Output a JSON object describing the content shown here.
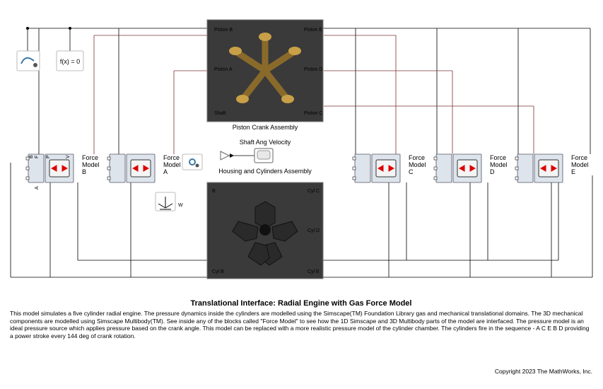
{
  "title": "Translational Interface: Radial Engine with Gas Force Model",
  "description": "This model simulates a five cylinder radial engine. The pressure dynamics inside the cylinders are modelled using the Simscape(TM) Foundation Library gas and mechanical translational domains. The 3D mechanical components are modelled using Simscape Multibody(TM). See inside any of the blocks called \"Force Model\" to see how the 1D Simscape and 3D Multibody parts of the model are interfaced. The pressure model is an ideal pressure source which applies pressure based on the crank angle. This model can be replaced with a more realistic pressure model of the cylinder chamber. The cylinders fire in the sequence - A C E B D providing a power stroke every 144 deg of crank rotation.",
  "copyright": "Copyright 2023 The MathWorks, Inc.",
  "solver": {
    "fx": "f(x) = 0"
  },
  "piston_block": {
    "caption": "Piston   Crank Assembly",
    "ports": {
      "pa": "Piston A",
      "pb": "Piston B",
      "pc": "Piston C",
      "pd": "Piston D",
      "pe": "Piston E",
      "shaft": "Shaft"
    }
  },
  "housing_block": {
    "caption": "Housing and Cylinders Assembly",
    "top_label": "Shaft Ang Velocity",
    "ports": {
      "cb": "Cyl B",
      "cc": "Cyl C",
      "cd": "Cyl D",
      "ce": "Cyl E",
      "b": "B",
      "w": "W"
    }
  },
  "force_models": {
    "a": {
      "l1": "Force",
      "l2": "Model",
      "l3": "A"
    },
    "b": {
      "l1": "Force",
      "l2": "Model",
      "l3": "B"
    },
    "c": {
      "l1": "Force",
      "l2": "Model",
      "l3": "C"
    },
    "d": {
      "l1": "Force",
      "l2": "Model",
      "l3": "D"
    },
    "e": {
      "l1": "Force",
      "l2": "Model",
      "l3": "E"
    }
  },
  "ports": {
    "F": "F",
    "P": "P",
    "V": "V",
    "B": "B",
    "A": "A"
  }
}
